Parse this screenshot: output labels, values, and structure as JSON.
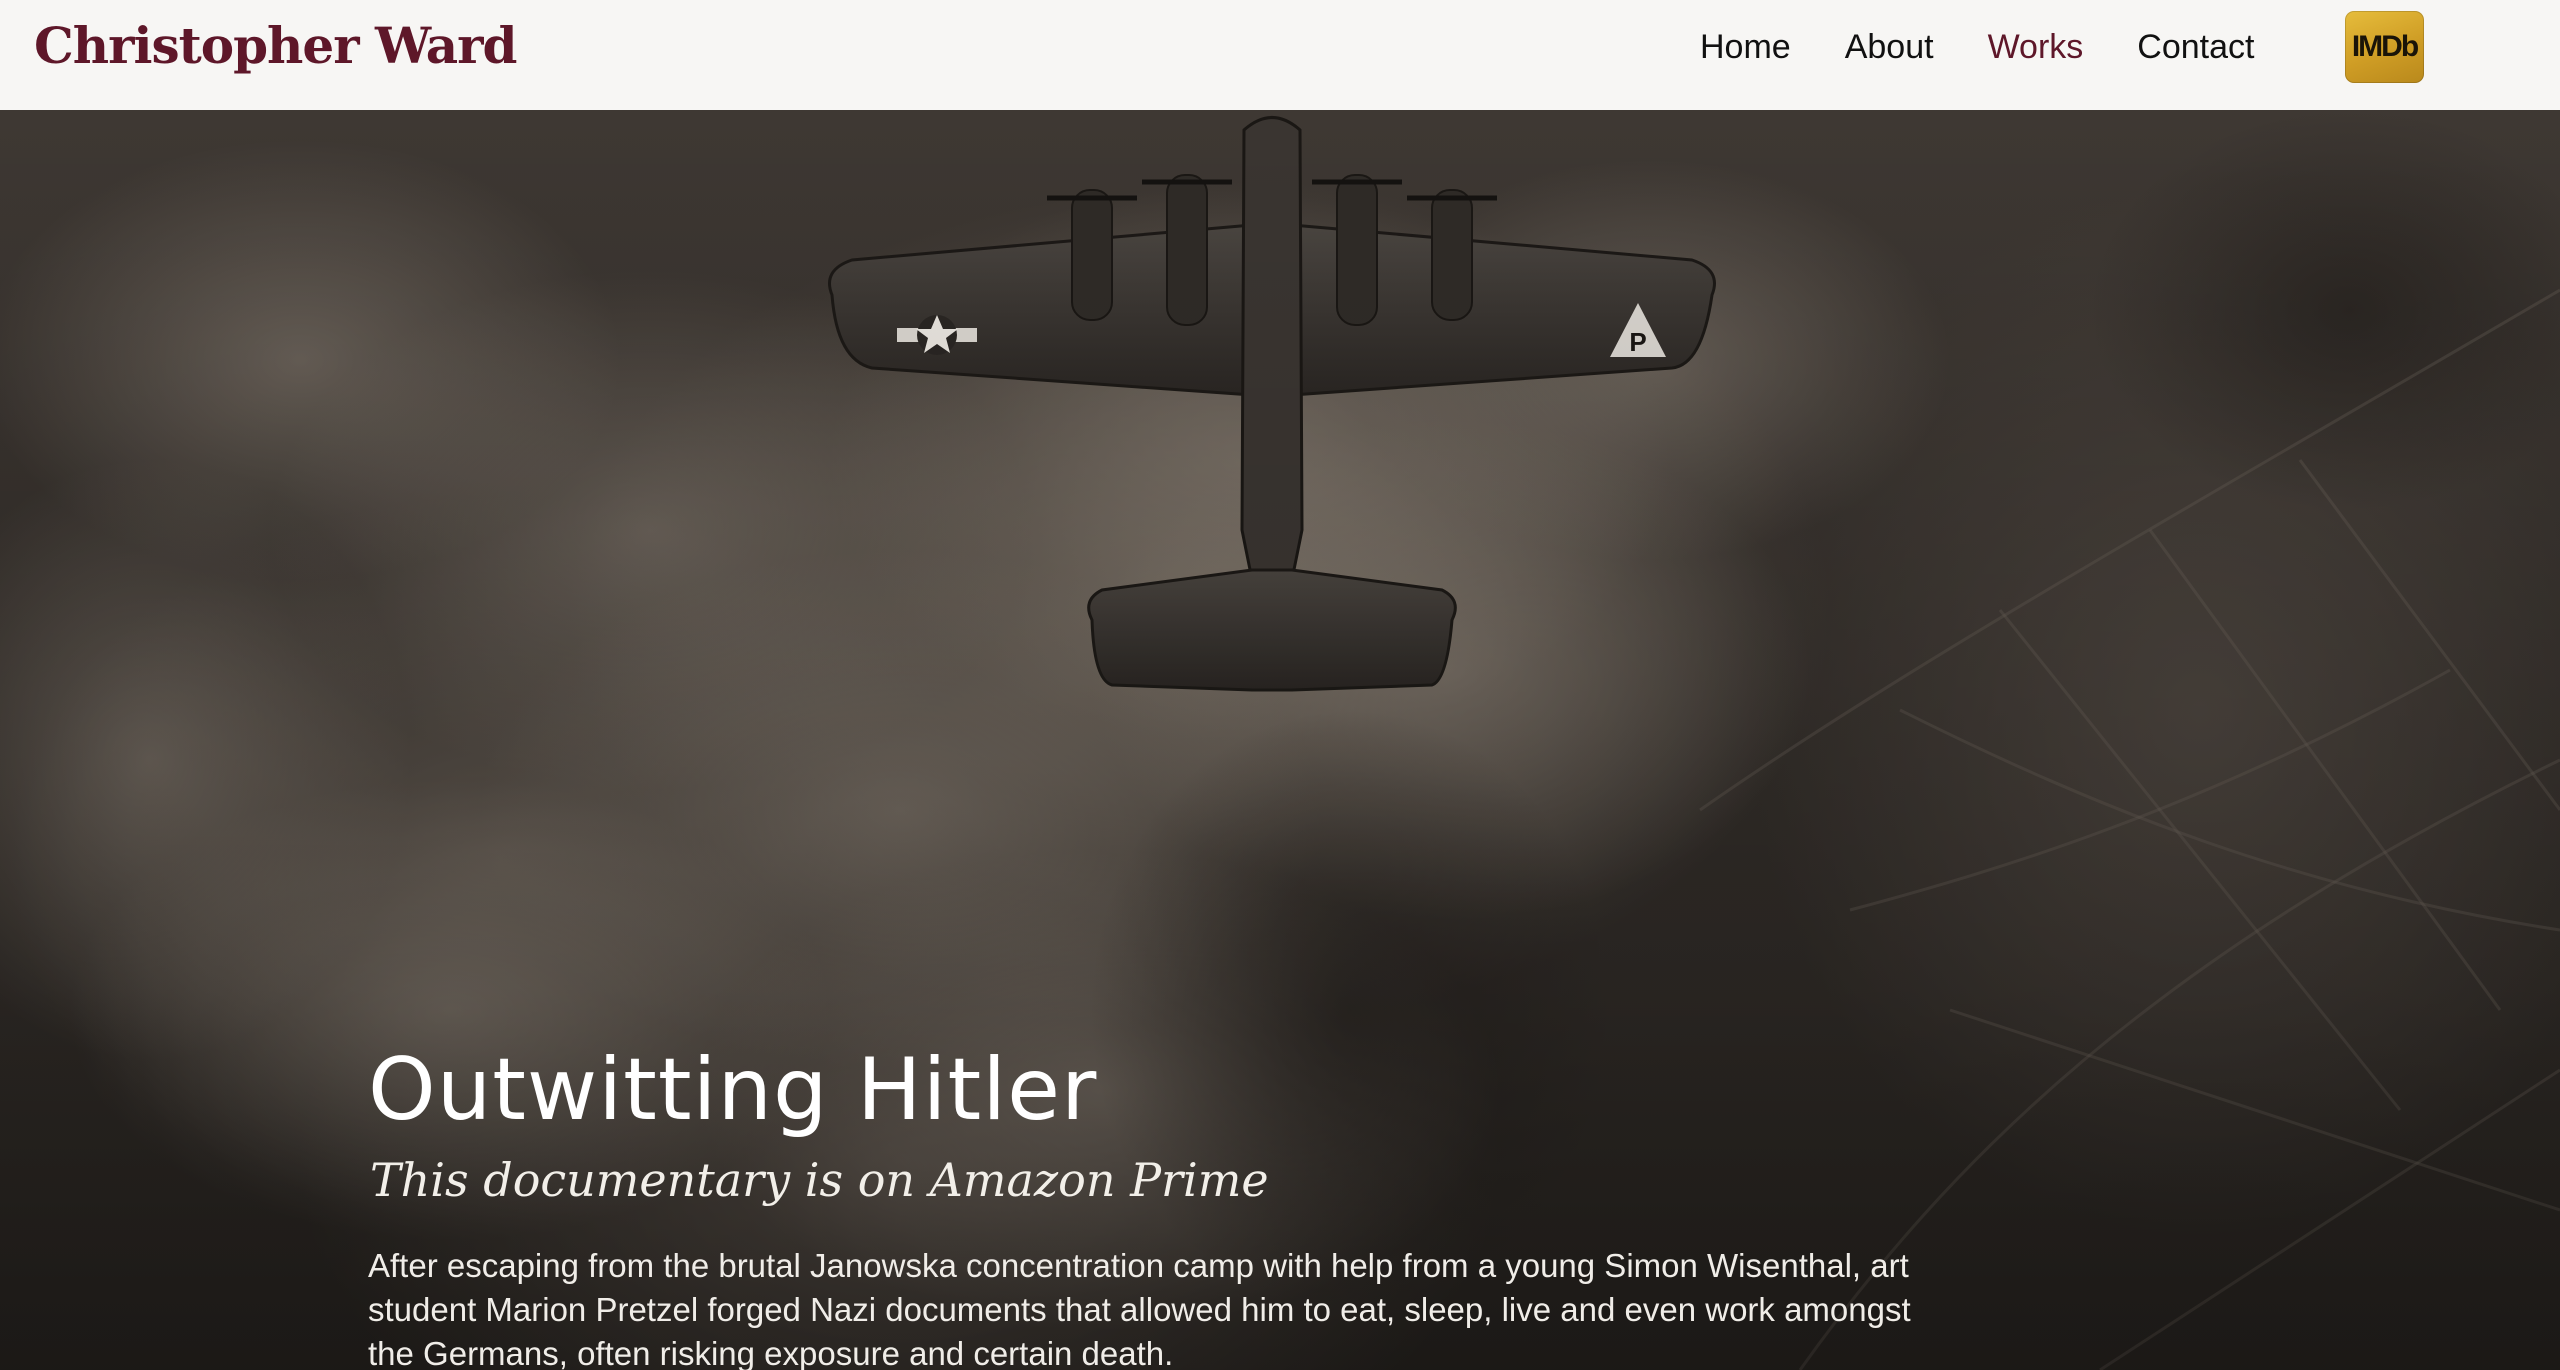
{
  "header": {
    "brand": "Christopher Ward",
    "nav": [
      {
        "label": "Home",
        "active": false
      },
      {
        "label": "About",
        "active": false
      },
      {
        "label": "Works",
        "active": true
      },
      {
        "label": "Contact",
        "active": false
      }
    ],
    "imdb_label": "IMDb"
  },
  "hero": {
    "title": "Outwitting Hitler",
    "subtitle": "This documentary is on Amazon Prime",
    "description": "After escaping from the brutal Janowska concentration camp with help from a young Simon Wisenthal, art student Marion Pretzel forged Nazi documents that allowed him to eat, sleep, live and even work amongst the Germans, often risking exposure and certain death.",
    "tail_marking": "P",
    "background_image": "aerial-bomber-over-smoke-photo"
  },
  "colors": {
    "brand": "#5e1729",
    "nav_text": "#111111",
    "header_bg": "#f7f6f4",
    "imdb_gold": "#e2b63a",
    "hero_text": "#ffffff"
  }
}
